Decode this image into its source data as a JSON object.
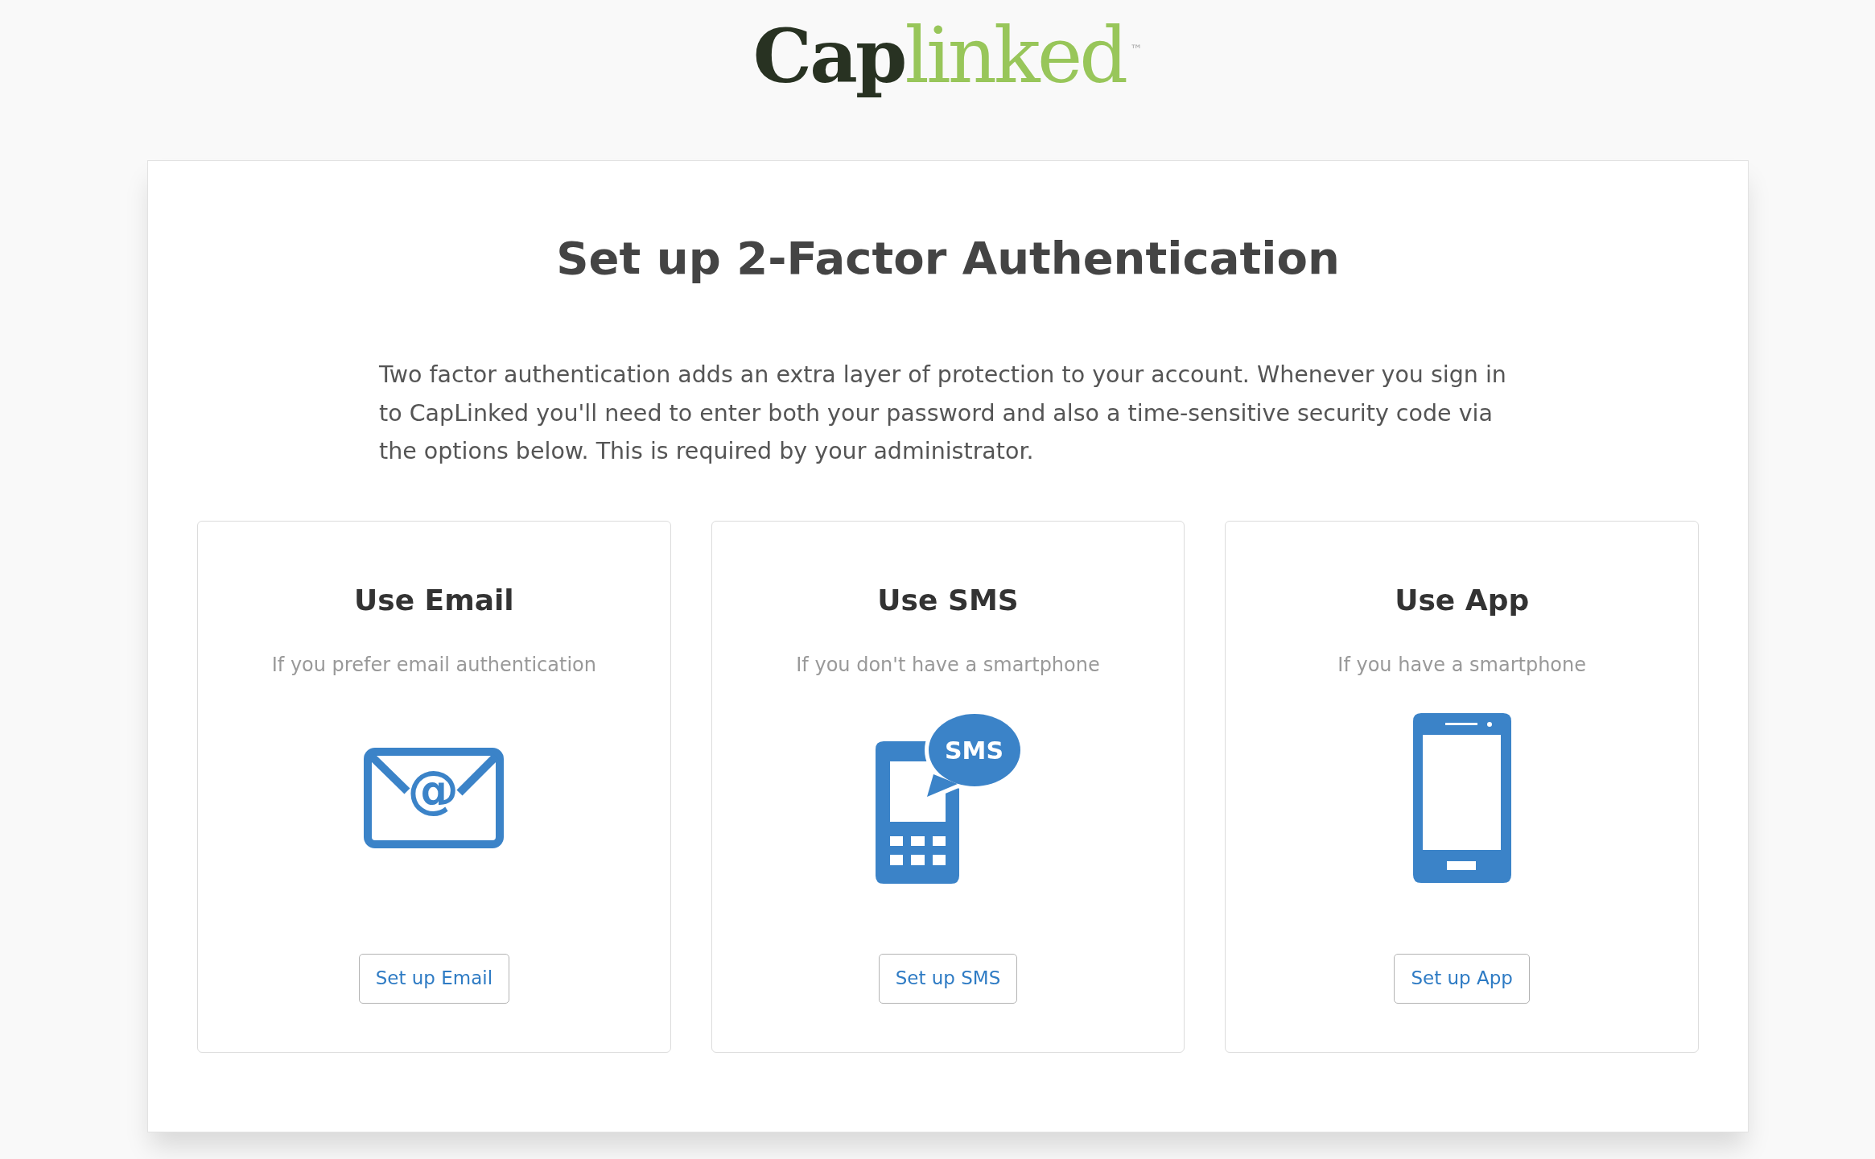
{
  "logo": {
    "dark_text": "Cap",
    "light_text": "linked",
    "trademark": "™"
  },
  "title": "Set up 2-Factor Authentication",
  "intro": "Two factor authentication adds an extra layer of protection to your account. Whenever you sign in to CapLinked you'll need to enter both your password and also a time-sensitive security code via the options below. This is required by your administrator.",
  "options": [
    {
      "kind": "email",
      "title": "Use Email",
      "subtitle": "If you prefer email authentication",
      "icon_text": "@",
      "button": "Set up Email"
    },
    {
      "kind": "sms",
      "title": "Use SMS",
      "subtitle": "If you don't have a smartphone",
      "icon_text": "SMS",
      "button": "Set up SMS"
    },
    {
      "kind": "app",
      "title": "Use App",
      "subtitle": "If you have a smartphone",
      "button": "Set up App"
    }
  ]
}
